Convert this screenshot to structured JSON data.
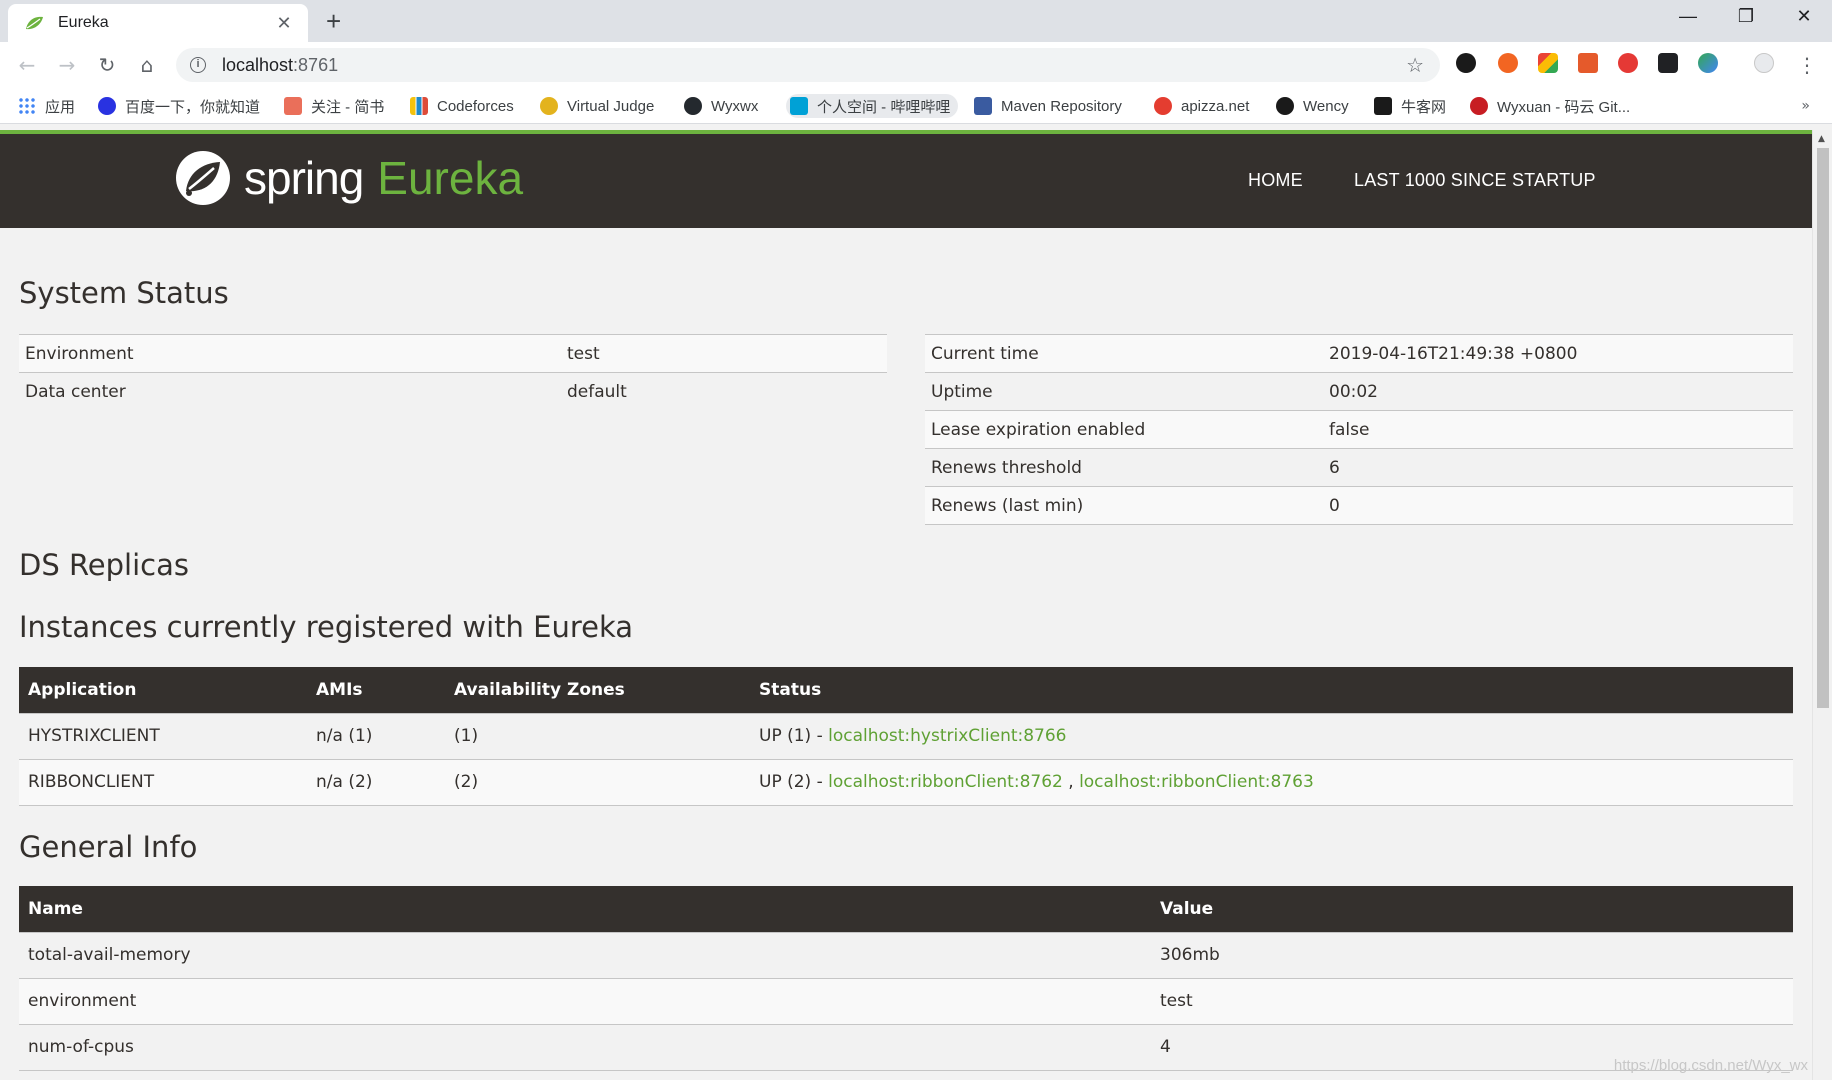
{
  "browser": {
    "tab_title": "Eureka",
    "tab_close": "✕",
    "new_tab": "+",
    "window_controls": {
      "minimize": "—",
      "maximize": "❐",
      "close": "✕"
    },
    "nav": {
      "back": "←",
      "forward": "→",
      "reload": "↻",
      "home": "⌂"
    },
    "url_host": "localhost",
    "url_port": ":8761",
    "bookmark_star": "☆",
    "menu": "⋮",
    "bookmarks": [
      {
        "label": "应用",
        "icon": "apps-grid-icon",
        "color": "#4285f4"
      },
      {
        "label": "百度一下，你就知道",
        "icon": "baidu-paw-icon",
        "color": "#2932e1"
      },
      {
        "label": "关注 - 简书",
        "icon": "jianshu-icon",
        "color": "#ea6f5a"
      },
      {
        "label": "Codeforces",
        "icon": "codeforces-bars-icon",
        "color": "#1f8acb"
      },
      {
        "label": "Virtual Judge",
        "icon": "virtual-judge-icon",
        "color": "#e3b31e"
      },
      {
        "label": "Wyxwx",
        "icon": "github-icon",
        "color": "#24292e"
      },
      {
        "label": "个人空间 - 哔哩哔哩",
        "icon": "bilibili-icon",
        "color": "#00a1d6"
      },
      {
        "label": "Maven Repository",
        "icon": "mvn-icon",
        "color": "#3a5ba0"
      },
      {
        "label": "apizza.net",
        "icon": "apizza-icon",
        "color": "#e43d30"
      },
      {
        "label": "Wency",
        "icon": "wency-icon",
        "color": "#1a1a1a"
      },
      {
        "label": "牛客网",
        "icon": "nowcoder-icon",
        "color": "#1a1a1a"
      },
      {
        "label": "Wyxuan - 码云 Git...",
        "icon": "gitee-icon",
        "color": "#c71d23"
      }
    ],
    "bookmarks_more": "»"
  },
  "page": {
    "brand_spring": "spring",
    "brand_eureka": "Eureka",
    "nav_home": "HOME",
    "nav_last1000": "LAST 1000 SINCE STARTUP",
    "system_status_title": "System Status",
    "system_status_left": [
      {
        "label": "Environment",
        "value": "test"
      },
      {
        "label": "Data center",
        "value": "default"
      }
    ],
    "system_status_right": [
      {
        "label": "Current time",
        "value": "2019-04-16T21:49:38 +0800"
      },
      {
        "label": "Uptime",
        "value": "00:02"
      },
      {
        "label": "Lease expiration enabled",
        "value": "false"
      },
      {
        "label": "Renews threshold",
        "value": "6"
      },
      {
        "label": "Renews (last min)",
        "value": "0"
      }
    ],
    "ds_replicas_title": "DS Replicas",
    "instances_title": "Instances currently registered with Eureka",
    "instances_headers": [
      "Application",
      "AMIs",
      "Availability Zones",
      "Status"
    ],
    "instances": [
      {
        "application": "HYSTRIXCLIENT",
        "amis": "n/a (1)",
        "zones": "(1)",
        "status_prefix": "UP (1) - ",
        "links": [
          "localhost:hystrixClient:8766"
        ]
      },
      {
        "application": "RIBBONCLIENT",
        "amis": "n/a (2)",
        "zones": "(2)",
        "status_prefix": "UP (2) - ",
        "links": [
          "localhost:ribbonClient:8762",
          "localhost:ribbonClient:8763"
        ]
      }
    ],
    "link_separator": " , ",
    "general_info_title": "General Info",
    "general_info_headers": [
      "Name",
      "Value"
    ],
    "general_info": [
      {
        "name": "total-avail-memory",
        "value": "306mb"
      },
      {
        "name": "environment",
        "value": "test"
      },
      {
        "name": "num-of-cpus",
        "value": "4"
      }
    ],
    "watermark": "https://blog.csdn.net/Wyx_wx"
  },
  "colors": {
    "spring_green": "#6db33f",
    "header_dark": "#34302d",
    "link_green": "#5fa134"
  }
}
